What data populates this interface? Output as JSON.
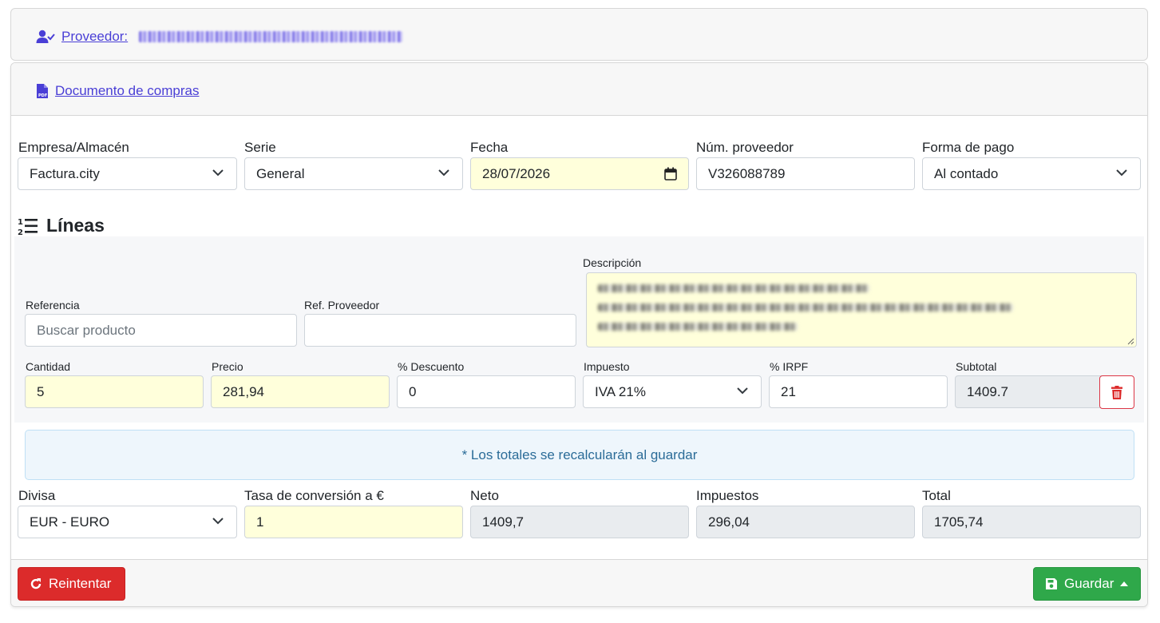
{
  "provider": {
    "label": "Proveedor:",
    "icon": "user-check-icon"
  },
  "document": {
    "label": "Documento de compras",
    "icon": "pdf-file-icon"
  },
  "header_fields": {
    "empresa": {
      "label": "Empresa/Almacén",
      "value": "Factura.city"
    },
    "serie": {
      "label": "Serie",
      "value": "General"
    },
    "fecha": {
      "label": "Fecha",
      "value": "28/07/2026"
    },
    "num_proveedor": {
      "label": "Núm. proveedor",
      "value": "V326088789"
    },
    "forma_pago": {
      "label": "Forma de pago",
      "value": "Al contado"
    }
  },
  "lines": {
    "title": "Líneas",
    "referencia": {
      "label": "Referencia",
      "placeholder": "Buscar producto"
    },
    "ref_proveedor": {
      "label": "Ref. Proveedor",
      "value": ""
    },
    "descripcion": {
      "label": "Descripción"
    },
    "cantidad": {
      "label": "Cantidad",
      "value": "5"
    },
    "precio": {
      "label": "Precio",
      "value": "281,94"
    },
    "descuento": {
      "label": "% Descuento",
      "value": "0"
    },
    "impuesto": {
      "label": "Impuesto",
      "value": "IVA 21%"
    },
    "irpf": {
      "label": "% IRPF",
      "value": "21"
    },
    "subtotal": {
      "label": "Subtotal",
      "value": "1409.7"
    }
  },
  "notice": "* Los totales se recalcularán al guardar",
  "totals": {
    "divisa": {
      "label": "Divisa",
      "value": "EUR - EURO"
    },
    "tasa": {
      "label": "Tasa de conversión a €",
      "value": "1"
    },
    "neto": {
      "label": "Neto",
      "value": "1409,7"
    },
    "impuestos": {
      "label": "Impuestos",
      "value": "296,04"
    },
    "total": {
      "label": "Total",
      "value": "1705,74"
    }
  },
  "buttons": {
    "retry": "Reintentar",
    "save": "Guardar"
  },
  "colors": {
    "link": "#4a3fd6",
    "danger": "#dc2b2b",
    "success": "#2fa84a",
    "highlight": "#ffffdb"
  }
}
